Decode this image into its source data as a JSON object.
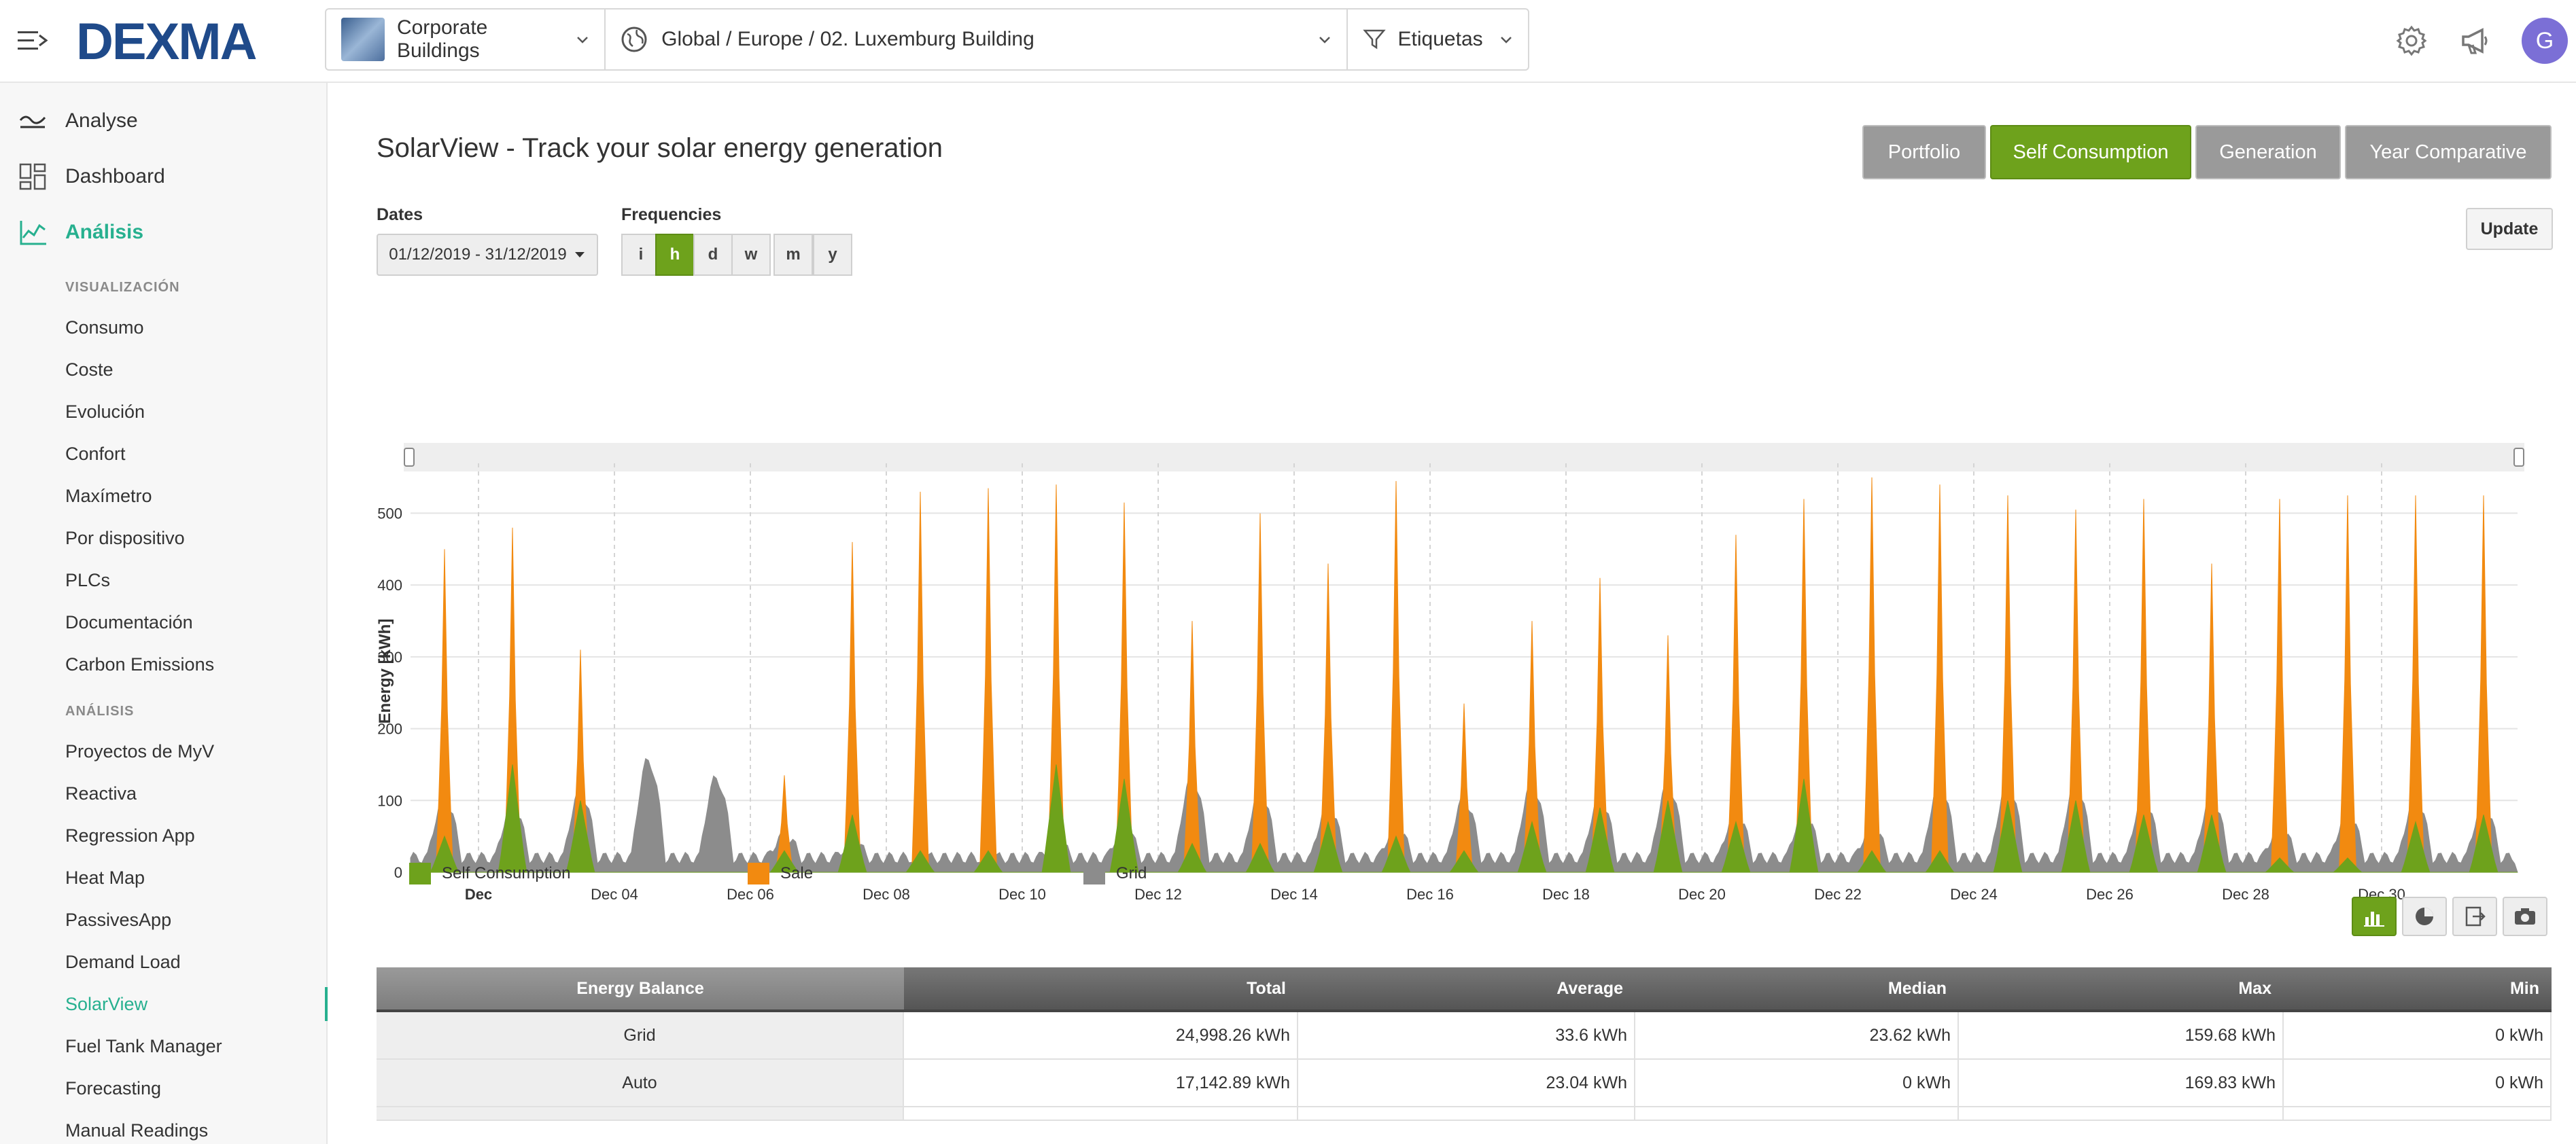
{
  "header": {
    "logo": "DEXMA",
    "org_selector": "Corporate Buildings",
    "location_path": "Global / Europe / 02. Luxemburg Building",
    "tags_label": "Etiquetas",
    "avatar_initial": "G"
  },
  "sidebar": {
    "section_title": "Analyse",
    "dashboard": "Dashboard",
    "analysis": "Análisis",
    "group1_title": "VISUALIZACIÓN",
    "group1_items": [
      "Consumo",
      "Coste",
      "Evolución",
      "Confort",
      "Maxímetro",
      "Por dispositivo",
      "PLCs",
      "Documentación",
      "Carbon Emissions"
    ],
    "group2_title": "ANÁLISIS",
    "group2_items": [
      "Proyectos de MyV",
      "Reactiva",
      "Regression App",
      "Heat Map",
      "PassivesApp",
      "Demand Load",
      "SolarView",
      "Fuel Tank Manager",
      "Forecasting",
      "Manual Readings"
    ],
    "active_item": "SolarView"
  },
  "main": {
    "title": "SolarView - Track your solar energy generation",
    "tabs": [
      "Portfolio",
      "Self Consumption",
      "Generation",
      "Year Comparative"
    ],
    "active_tab": "Self Consumption",
    "update_label": "Update",
    "dates_label": "Dates",
    "date_range": "01/12/2019 - 31/12/2019",
    "frequencies_label": "Frequencies",
    "frequencies": [
      "i",
      "h",
      "d",
      "w",
      "m",
      "y"
    ],
    "active_frequency": "h"
  },
  "colors": {
    "self_consumption": "#6ea21c",
    "sale": "#f28a10",
    "grid": "#8c8c8c",
    "accent": "#27b08f"
  },
  "chart_data": {
    "type": "area",
    "ylabel": "Energy [kWh]",
    "yticks": [
      0,
      100,
      200,
      300,
      400,
      500
    ],
    "ylim": [
      0,
      560
    ],
    "x_tick_labels": [
      "Dec",
      "Dec 04",
      "Dec 06",
      "Dec 08",
      "Dec 10",
      "Dec 12",
      "Dec 14",
      "Dec 16",
      "Dec 18",
      "Dec 20",
      "Dec 22",
      "Dec 24",
      "Dec 26",
      "Dec 28",
      "Dec 30"
    ],
    "x_days": [
      2,
      4,
      6,
      8,
      10,
      12,
      14,
      16,
      18,
      20,
      22,
      24,
      26,
      28,
      30
    ],
    "days": [
      1,
      2,
      3,
      4,
      5,
      6,
      7,
      8,
      9,
      10,
      11,
      12,
      13,
      14,
      15,
      16,
      17,
      18,
      19,
      20,
      21,
      22,
      23,
      24,
      25,
      26,
      27,
      28,
      29,
      30,
      31
    ],
    "series": [
      {
        "name": "Self Consumption",
        "daily_peak": [
          50,
          150,
          100,
          0,
          0,
          30,
          80,
          30,
          30,
          150,
          130,
          40,
          40,
          70,
          50,
          30,
          70,
          90,
          100,
          70,
          130,
          30,
          30,
          100,
          100,
          80,
          80,
          20,
          20,
          70,
          80
        ]
      },
      {
        "name": "Sale",
        "daily_peak": [
          450,
          480,
          310,
          0,
          0,
          135,
          460,
          530,
          535,
          540,
          515,
          350,
          500,
          430,
          545,
          235,
          350,
          410,
          330,
          470,
          520,
          550,
          540,
          525,
          505,
          520,
          430,
          520,
          525,
          525,
          525
        ]
      },
      {
        "name": "Grid",
        "daily_peak": [
          100,
          90,
          110,
          155,
          130,
          50,
          40,
          20,
          20,
          40,
          60,
          130,
          110,
          90,
          60,
          100,
          120,
          100,
          120,
          80,
          80,
          60,
          120,
          120,
          120,
          100,
          100,
          60,
          80,
          100,
          90
        ]
      }
    ],
    "legend": [
      "Self Consumption",
      "Sale",
      "Grid"
    ],
    "legend_position": "bottom"
  },
  "table": {
    "columns": [
      "Energy Balance",
      "Total",
      "Average",
      "Median",
      "Max",
      "Min"
    ],
    "rows": [
      {
        "label": "Grid",
        "total": "24,998.26 kWh",
        "average": "33.6 kWh",
        "median": "23.62 kWh",
        "max": "159.68 kWh",
        "min": "0 kWh"
      },
      {
        "label": "Auto",
        "total": "17,142.89 kWh",
        "average": "23.04 kWh",
        "median": "0 kWh",
        "max": "169.83 kWh",
        "min": "0 kWh"
      }
    ]
  }
}
